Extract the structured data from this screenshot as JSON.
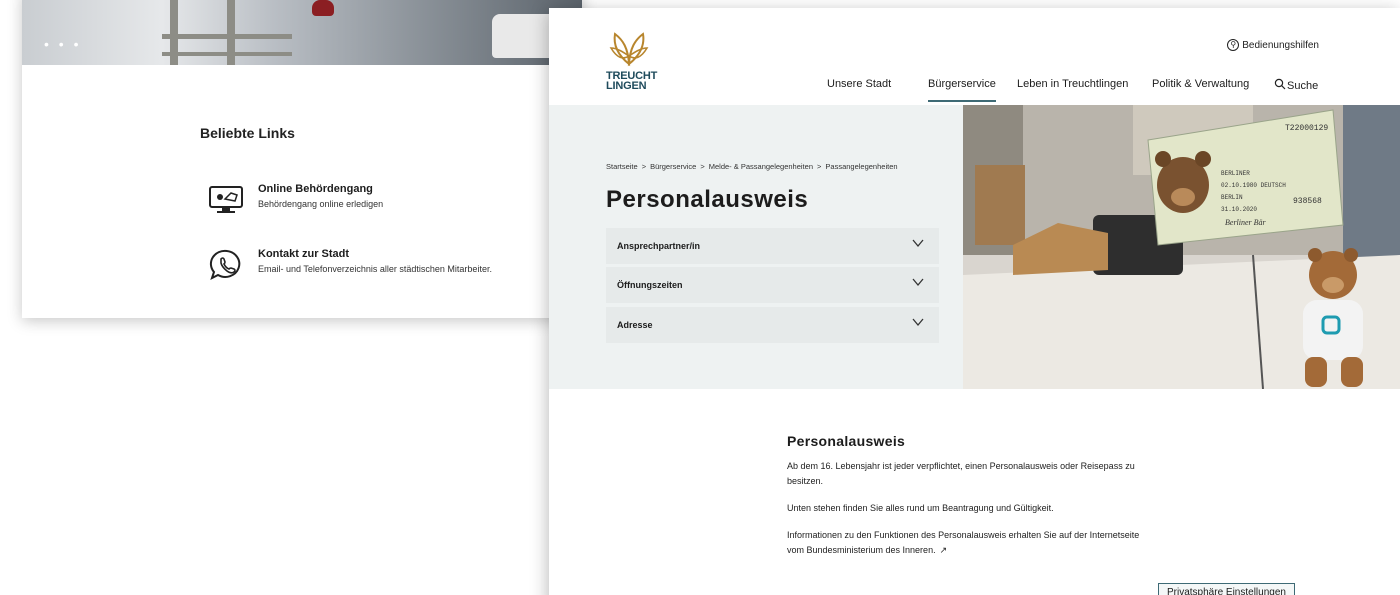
{
  "back_page": {
    "slider_dots": "• • •",
    "popular_links": {
      "title": "Beliebte Links",
      "items": [
        {
          "title": "Online Behördengang",
          "subtitle": "Behördengang online erledigen",
          "icon": "computer-hand-icon"
        },
        {
          "title": "Kontakt zur Stadt",
          "subtitle": "Email- und Telefonverzeichnis aller städtischen Mitarbeiter.",
          "icon": "phone-bubble-icon"
        }
      ]
    }
  },
  "front_page": {
    "logo": {
      "line1": "TREUCHT",
      "line2": "LINGEN",
      "icon": "leaf-logo-icon"
    },
    "accessibility": {
      "label": "Bedienungshilfen",
      "icon": "accessibility-icon"
    },
    "nav": {
      "items": [
        "Unsere Stadt",
        "Bürgerservice",
        "Leben in Treuchtlingen",
        "Politik & Verwaltung"
      ],
      "active": "Bürgerservice",
      "search_label": "Suche"
    },
    "breadcrumb": [
      "Startseite",
      "Bürgerservice",
      "Melde- & Passangelegenheiten",
      "Passangelegenheiten"
    ],
    "breadcrumb_separator": ">",
    "page_title": "Personalausweis",
    "accordion": [
      "Ansprechpartner/in",
      "Öffnungszeiten",
      "Adresse"
    ],
    "hero_image_card": {
      "number": "T22000129",
      "line1": "BERLINER",
      "line2": "02.10.1980 DEUTSCH",
      "line3": "BERLIN",
      "line4": "31.10.2020",
      "code": "938568",
      "signature": "Berliner Bär"
    },
    "content": {
      "title": "Personalausweis",
      "paragraphs": [
        "Ab dem 16. Lebensjahr ist jeder verpflichtet, einen Personalausweis oder Reisepass zu besitzen.",
        "Unten stehen finden Sie alles rund um Beantragung und Gültigkeit.",
        "Informationen zu den Funktionen des Personalausweis erhalten Sie auf der Internetseite vom Bundesministerium des Inneren."
      ],
      "external_link_icon": "↗"
    },
    "privacy_button": "Privatsphäre Einstellungen"
  },
  "colors": {
    "accent": "#3e6a75",
    "logo_gold": "#b8862e",
    "hero_panel": "#eef2f2",
    "accordion_bg": "#e6eaea"
  }
}
